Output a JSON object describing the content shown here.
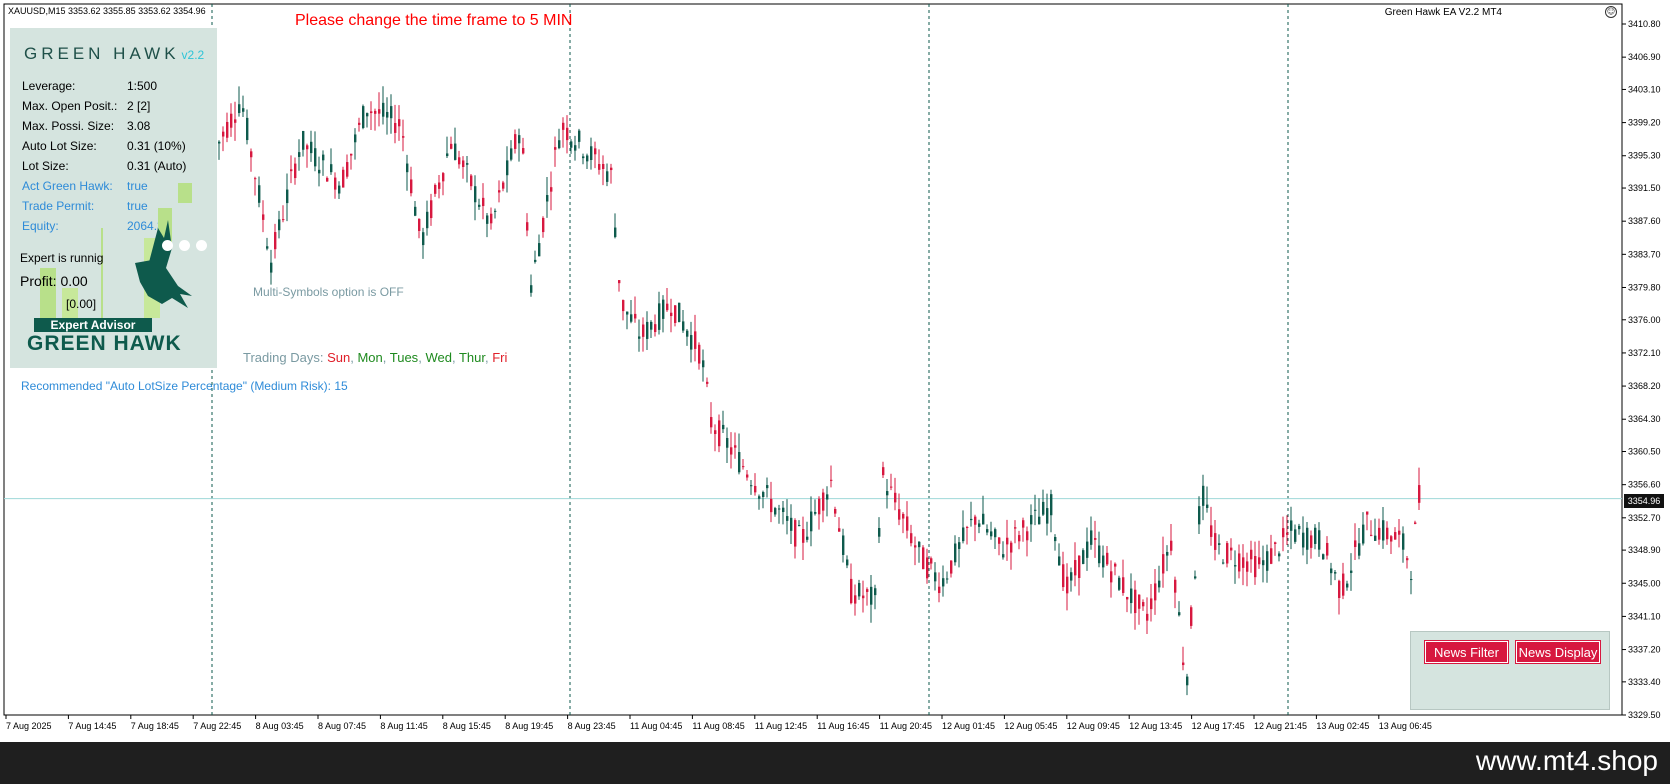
{
  "chart": {
    "symbol_info": "XAUUSD,M15  3353.62 3355.85 3353.62 3354.96",
    "warning": "Please change the time frame to 5 MIN",
    "ea_label": "Green Hawk EA V2.2 MT4",
    "current_price": "3354.96",
    "price_labels": [
      "3410.80",
      "3406.90",
      "3403.10",
      "3399.20",
      "3395.30",
      "3391.50",
      "3387.60",
      "3383.70",
      "3379.80",
      "3376.00",
      "3372.10",
      "3368.20",
      "3364.30",
      "3360.50",
      "3356.60",
      "3352.70",
      "3348.90",
      "3345.00",
      "3341.10",
      "3337.20",
      "3333.40",
      "3329.50"
    ],
    "time_labels": [
      "7 Aug 2025",
      "7 Aug 14:45",
      "7 Aug 18:45",
      "7 Aug 22:45",
      "8 Aug 03:45",
      "8 Aug 07:45",
      "8 Aug 11:45",
      "8 Aug 15:45",
      "8 Aug 19:45",
      "8 Aug 23:45",
      "11 Aug 04:45",
      "11 Aug 08:45",
      "11 Aug 12:45",
      "11 Aug 16:45",
      "11 Aug 20:45",
      "12 Aug 01:45",
      "12 Aug 05:45",
      "12 Aug 09:45",
      "12 Aug 13:45",
      "12 Aug 17:45",
      "12 Aug 21:45",
      "13 Aug 02:45",
      "13 Aug 06:45"
    ],
    "colors": {
      "bull": "#0e5a4c",
      "bear": "#d7183f",
      "grid": "#0e5a4c",
      "bid_line": "#9ed8d8"
    }
  },
  "panel": {
    "title": "GREEN HAWK",
    "version": "v2.2",
    "rows": [
      {
        "label": "Leverage:",
        "value": "1:500"
      },
      {
        "label": "Max. Open Posit.:",
        "value": "2 [2]"
      },
      {
        "label": "Max. Possi. Size:",
        "value": "3.08"
      },
      {
        "label": "Auto Lot Size:",
        "value": "0.31 (10%)"
      },
      {
        "label": "Lot Size:",
        "value": "0.31 (Auto)"
      },
      {
        "label": "Act Green Hawk:",
        "value": "true"
      },
      {
        "label": "Trade Permit:",
        "value": "true"
      },
      {
        "label": "Equity:",
        "value": "2064.32"
      }
    ],
    "status": "Expert is runnig",
    "profit_label": "Profit:",
    "profit_value": "0.00",
    "profit_sub": "[0.00]",
    "badge": "Expert Advisor",
    "logo_text": "GREEN HAWK"
  },
  "info": {
    "multi_symbols": "Multi-Symbols option is OFF",
    "trading_days_label": "Trading Days:",
    "days": [
      {
        "name": "Sun",
        "sep": ",",
        "active": false
      },
      {
        "name": "Mon",
        "sep": ",",
        "active": true
      },
      {
        "name": "Tues",
        "sep": ",",
        "active": true
      },
      {
        "name": "Wed",
        "sep": ",",
        "active": true
      },
      {
        "name": "Thur",
        "sep": ",",
        "active": true
      },
      {
        "name": "Fri",
        "sep": "",
        "active": false
      }
    ],
    "recommendation": "Recommended \"Auto LotSize Percentage\" (Medium Risk): 15"
  },
  "news": {
    "filter_label": "News Filter",
    "display_label": "News Display"
  },
  "footer": {
    "site": "www.mt4.shop"
  }
}
